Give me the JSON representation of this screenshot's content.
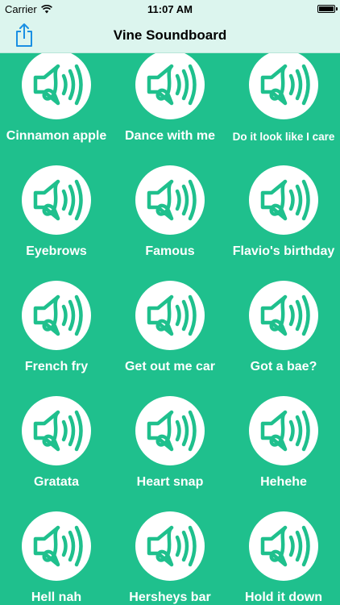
{
  "status_bar": {
    "carrier": "Carrier",
    "time": "11:07 AM"
  },
  "nav": {
    "title": "Vine Soundboard",
    "share_icon": "share-icon"
  },
  "colors": {
    "background": "#1fc08d",
    "nav_background": "#dcf5ee",
    "accent": "#1a8fe3",
    "icon_stroke": "#1fc08d"
  },
  "sounds": [
    {
      "label": "Cinnamon apple"
    },
    {
      "label": "Dance with me"
    },
    {
      "label": "Do it look like I care"
    },
    {
      "label": "Eyebrows"
    },
    {
      "label": "Famous"
    },
    {
      "label": "Flavio's birthday"
    },
    {
      "label": "French fry"
    },
    {
      "label": "Get out me car"
    },
    {
      "label": "Got a bae?"
    },
    {
      "label": "Gratata"
    },
    {
      "label": "Heart snap"
    },
    {
      "label": "Hehehe"
    },
    {
      "label": "Hell nah"
    },
    {
      "label": "Hersheys bar"
    },
    {
      "label": "Hold it down"
    }
  ]
}
